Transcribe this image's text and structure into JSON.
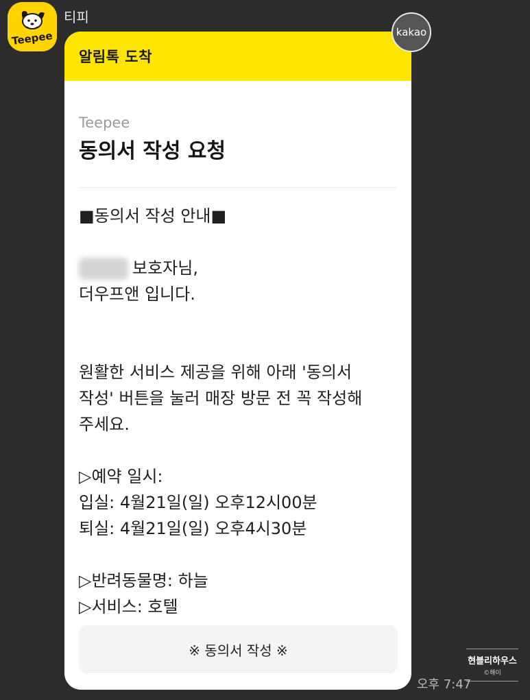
{
  "sender": {
    "name": "티피",
    "logo_text": "Teepee",
    "avatar_color": "#ffd400"
  },
  "card": {
    "header_title": "알림톡 도착",
    "header_color": "#fee500",
    "channel_label": "Teepee",
    "title": "동의서 작성 요청",
    "lines": {
      "section_heading": "■동의서 작성 안내■",
      "greeting_suffix": "보호자님,",
      "greeting_line2": "더우프앤 입니다.",
      "body": "원활한 서비스 제공을 위해 아래 '동의서\n작성' 버튼을 눌러 매장 방문 전 꼭 작성해\n주세요.",
      "reservation_heading": "▷예약 일시:",
      "checkin": "입실: 4월21일(일) 오후12시00분",
      "checkout": "퇴실: 4월21일(일) 오후4시30분",
      "pet_name": "▷반려동물명: 하늘",
      "service": "▷서비스: 호텔"
    },
    "button_label": "※ 동의서 작성 ※"
  },
  "kakao_badge": "kakao",
  "timestamp": "오후 7:47",
  "watermark": {
    "main": "현블리하우스",
    "sub": "©해이"
  }
}
